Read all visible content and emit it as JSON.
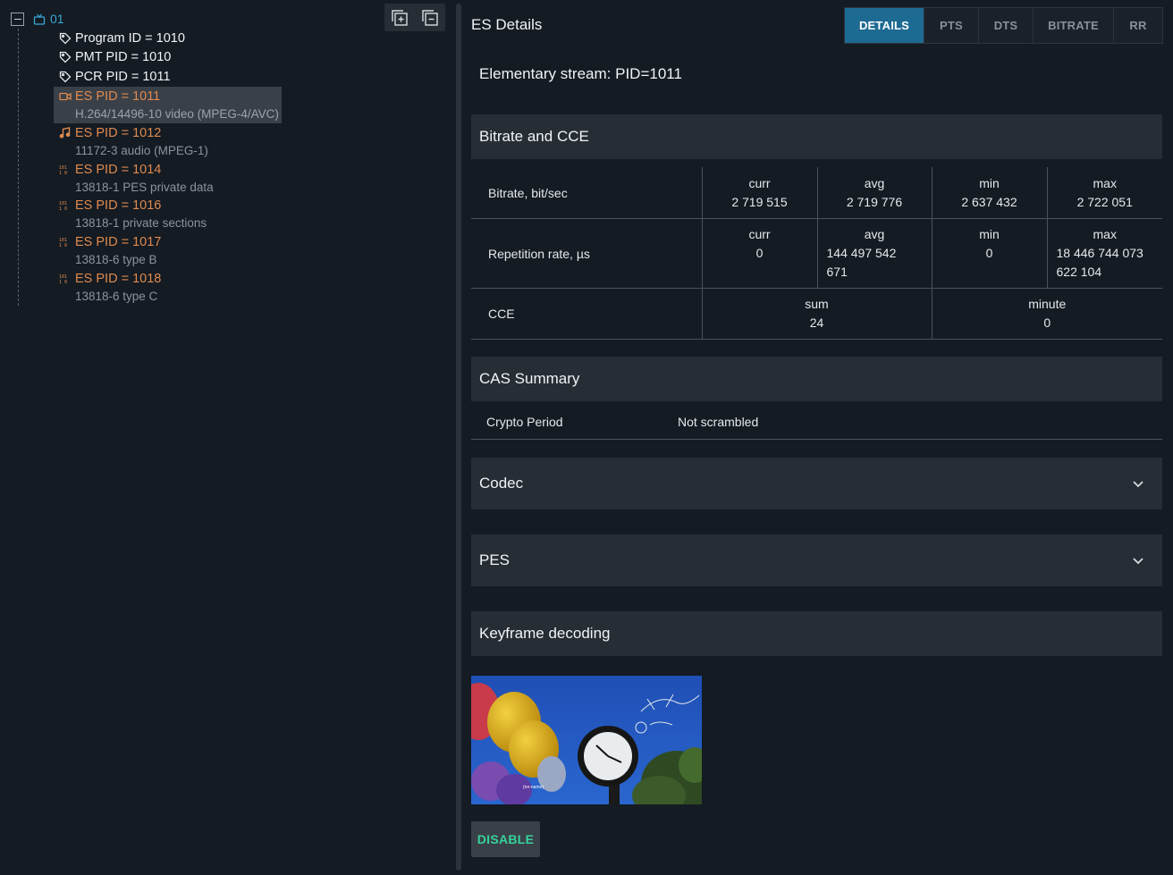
{
  "tree": {
    "root": {
      "label": "01"
    },
    "items": [
      {
        "label": "Program ID = 1010",
        "icon": "tag-icon",
        "color": "white"
      },
      {
        "label": "PMT PID = 1010",
        "icon": "tag-icon",
        "color": "white"
      },
      {
        "label": "PCR PID = 1011",
        "icon": "tag-icon",
        "color": "white"
      },
      {
        "label": "ES PID = 1011",
        "sub": "H.264/14496-10 video (MPEG-4/AVC)",
        "icon": "video-camera-icon",
        "color": "orange",
        "selected": true
      },
      {
        "label": "ES PID = 1012",
        "sub": "11172-3 audio (MPEG-1)",
        "icon": "music-note-icon",
        "color": "orange"
      },
      {
        "label": "ES PID = 1014",
        "sub": "13818-1 PES private data",
        "icon": "binary-data-icon",
        "color": "orange"
      },
      {
        "label": "ES PID = 1016",
        "sub": "13818-1 private sections",
        "icon": "binary-data-icon",
        "color": "orange"
      },
      {
        "label": "ES PID = 1017",
        "sub": "13818-6 type B",
        "icon": "binary-data-icon",
        "color": "orange"
      },
      {
        "label": "ES PID = 1018",
        "sub": "13818-6 type C",
        "icon": "binary-data-icon",
        "color": "orange"
      }
    ]
  },
  "header": {
    "title": "ES Details",
    "tabs": [
      "DETAILS",
      "PTS",
      "DTS",
      "BITRATE",
      "RR"
    ],
    "active_tab": "DETAILS"
  },
  "stream_title": "Elementary stream: PID=1011",
  "sections": {
    "bitrate_cce": "Bitrate and CCE",
    "cas_summary": "CAS Summary",
    "codec": "Codec",
    "pes": "PES",
    "keyframe": "Keyframe decoding"
  },
  "bitrate_table": {
    "bitrate": {
      "name": "Bitrate, bit/sec",
      "curr_label": "curr",
      "curr": "2 719 515",
      "avg_label": "avg",
      "avg": "2 719 776",
      "min_label": "min",
      "min": "2 637 432",
      "max_label": "max",
      "max": "2 722 051"
    },
    "repetition": {
      "name": "Repetition rate, µs",
      "curr_label": "curr",
      "curr": "0",
      "avg_label": "avg",
      "avg_line1": "144 497 542",
      "avg_line2": "671",
      "min_label": "min",
      "min": "0",
      "max_label": "max",
      "max_line1": "18 446 744 073",
      "max_line2": "622 104"
    },
    "cce": {
      "name": "CCE",
      "sum_label": "sum",
      "sum": "24",
      "minute_label": "minute",
      "minute": "0"
    }
  },
  "cas": {
    "key": "Crypto Period",
    "value": "Not scrambled"
  },
  "keyframe_caption": "(no-name)",
  "buttons": {
    "disable": "DISABLE"
  },
  "colors": {
    "accent_tab": "#1d6a93",
    "tree_root": "#39a8d8",
    "es_label": "#e08a4e",
    "disable_text": "#36d39b"
  }
}
